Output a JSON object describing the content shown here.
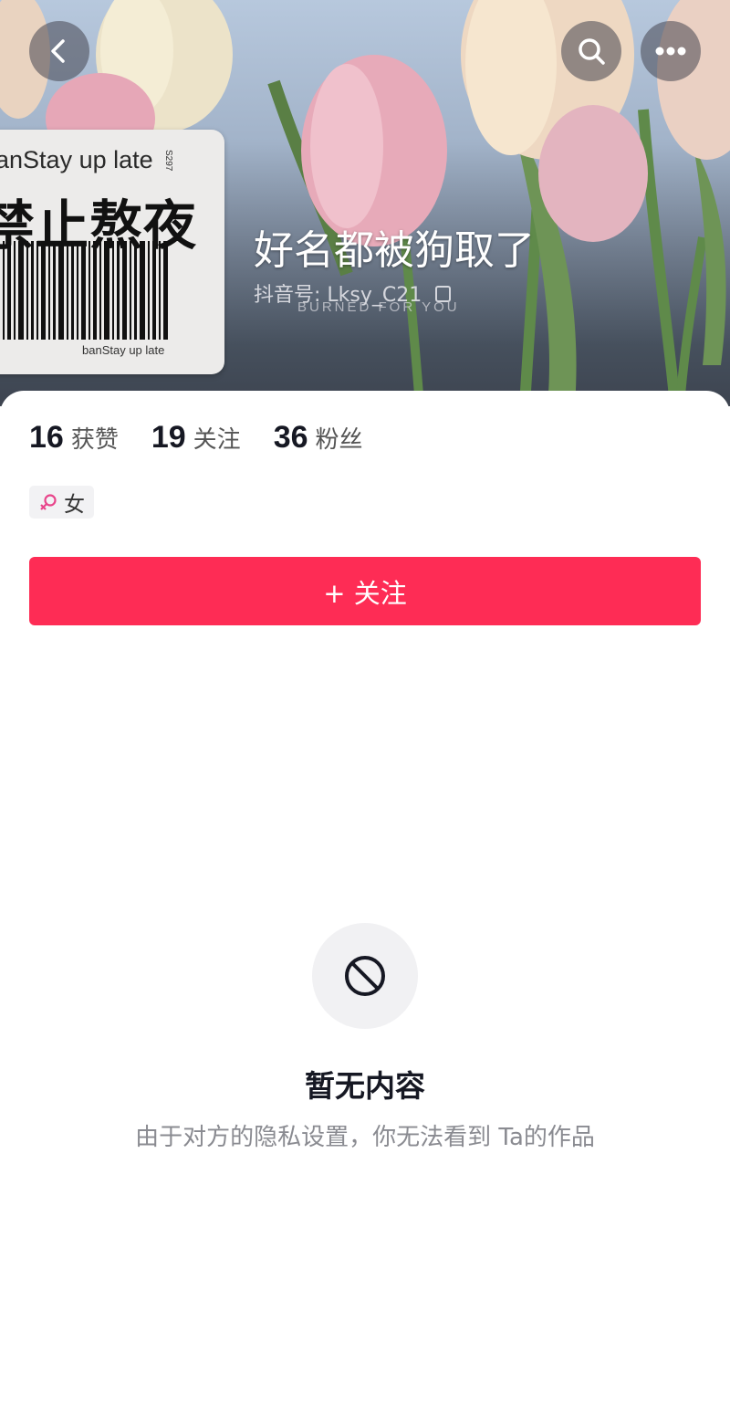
{
  "header": {
    "nickname": "好名都被狗取了",
    "douyin_id": "抖音号: Lksy_C21",
    "overlay_text": "BURNED  FOR  YOU"
  },
  "avatar": {
    "line1": "banStay up late",
    "line2": "禁止熬夜",
    "line3": "banStay up late",
    "code": "S297"
  },
  "stats": [
    {
      "num": "16",
      "label": "获赞"
    },
    {
      "num": "19",
      "label": "关注"
    },
    {
      "num": "36",
      "label": "粉丝"
    }
  ],
  "gender_tag": "女",
  "follow_button": "+ 关注",
  "empty_state": {
    "title": "暂无内容",
    "desc": "由于对方的隐私设置，你无法看到 Ta的作品"
  },
  "colors": {
    "accent": "#fe2c55",
    "female": "#e8458b"
  }
}
